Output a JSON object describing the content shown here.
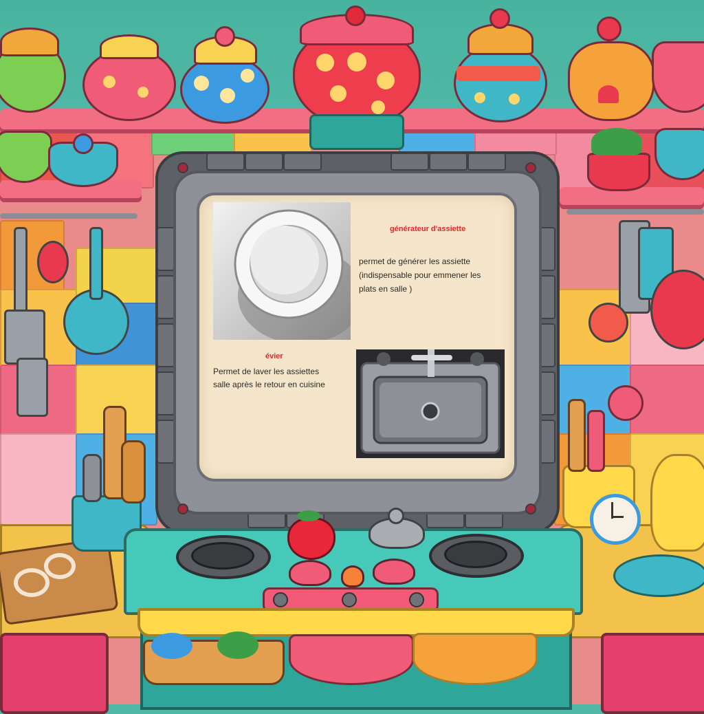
{
  "dialog": {
    "plate_generator": {
      "title": "générateur d'assiette",
      "description_line1": "permet de générer les assiette",
      "description_line2": "(indispensable pour emmener les",
      "description_line3": "plats en salle )"
    },
    "sink": {
      "title": "évier",
      "description_line1": "Permet de laver les assiettes",
      "description_line2": "salle après le retour en cuisine"
    }
  },
  "colors": {
    "title_red": "#e02a2a",
    "screen_bg": "#f5e6cb",
    "frame_gray": "#5d6066",
    "stove_teal": "#46c9b8"
  },
  "icons": {
    "plate": "plate-icon",
    "sink": "sink-icon",
    "clock": "clock-icon",
    "strawberry": "strawberry-icon"
  }
}
